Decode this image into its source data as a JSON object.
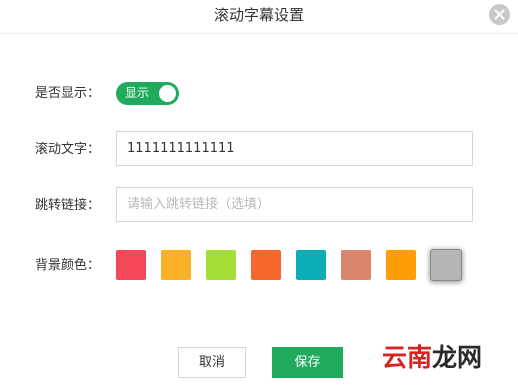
{
  "dialog": {
    "title": "滚动字幕设置",
    "close_icon": "close-icon"
  },
  "display_row": {
    "label": "是否显示：",
    "toggle_label": "显示",
    "toggle_on": true,
    "accent_color": "#1faa5e"
  },
  "text_row": {
    "label": "滚动文字：",
    "value": "1111111111111"
  },
  "link_row": {
    "label": "跳转链接：",
    "value": "",
    "placeholder": "请输入跳转链接（选填）"
  },
  "color_row": {
    "label": "背景颜色：",
    "colors": [
      "#f4475a",
      "#fbb025",
      "#a5de37",
      "#f5672c",
      "#0caeb5",
      "#da866e",
      "#fd9e06",
      "#b6b6b6"
    ],
    "selected_index": 7
  },
  "buttons": {
    "cancel_label": "取消",
    "save_label": "保存"
  },
  "watermark": {
    "red_part": "云南",
    "dark_part": "龙网"
  }
}
